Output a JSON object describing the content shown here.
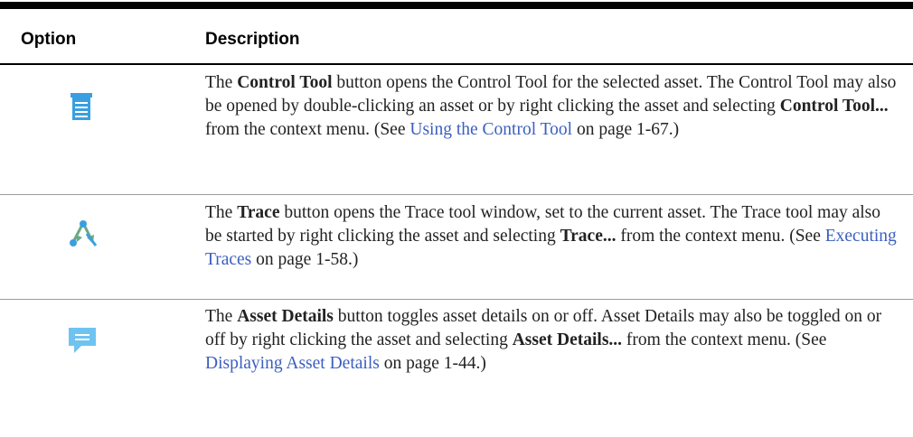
{
  "table": {
    "headers": {
      "option": "Option",
      "description": "Description"
    },
    "rows": [
      {
        "icon": "control-tool-icon",
        "segments": {
          "t0": "The ",
          "b0": "Control Tool",
          "t1": " button opens the Control Tool for the selected asset. The Control Tool may also be opened by double-clicking an asset or by right clicking the asset and selecting ",
          "b1": "Control Tool...",
          "t2": " from the context menu. (See ",
          "link": "Using the Control Tool",
          "t3": " on page 1-67.)"
        }
      },
      {
        "icon": "trace-icon",
        "segments": {
          "t0": "The ",
          "b0": "Trace",
          "t1": " button opens the Trace tool window, set to the current asset. The Trace tool may also be started by right clicking the asset and selecting ",
          "b1": "Trace...",
          "t2": " from the context menu. (See ",
          "link": "Executing Traces",
          "t3": " on page 1-58.)"
        }
      },
      {
        "icon": "asset-details-icon",
        "segments": {
          "t0": "The ",
          "b0": "Asset Details",
          "t1": " button toggles asset details on or off. Asset Details may also be toggled on or off by right clicking the asset and selecting ",
          "b1": "Asset Details...",
          "t2": " from the context menu. (See ",
          "link": "Displaying Asset Details",
          "t3": " on page 1-44.)"
        }
      }
    ]
  },
  "colors": {
    "icon_blue": "#3a9fe0",
    "icon_light_blue": "#6fc3f0",
    "icon_green": "#6aa985",
    "link": "#3b5fc0"
  }
}
